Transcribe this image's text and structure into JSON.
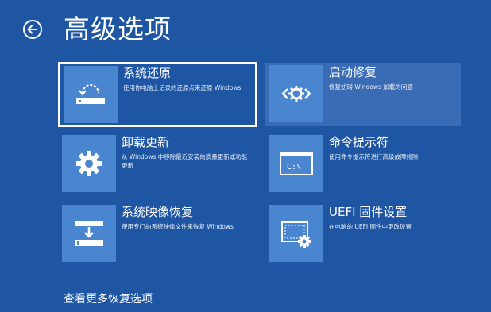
{
  "page": {
    "title": "高级选项",
    "more_link": "查看更多恢复选项"
  },
  "options": [
    {
      "name": "系统还原",
      "desc": "使用你电脑上记录的还原点来还原 Windows",
      "icon": "restore-icon"
    },
    {
      "name": "启动修复",
      "desc": "修复妨碍 Windows 加载的问题",
      "icon": "startup-repair-icon"
    },
    {
      "name": "卸载更新",
      "desc": "从 Windows 中移除最近安装的质量更新或功能更新",
      "icon": "gear-icon"
    },
    {
      "name": "命令提示符",
      "desc": "使用命令提示符进行高级故障排除",
      "icon": "command-prompt-icon",
      "prompt_text": "C:\\"
    },
    {
      "name": "系统映像恢复",
      "desc": "使用专门的系统映像文件来恢复 Windows",
      "icon": "image-recovery-icon"
    },
    {
      "name": "UEFI 固件设置",
      "desc": "在电脑的 UEFI 固件中更改设置",
      "icon": "uefi-settings-icon"
    }
  ],
  "colors": {
    "background": "#1e56a4",
    "icon_box": "#4a85cf",
    "hover_tile": "#3a6cb5",
    "text": "#ffffff"
  }
}
